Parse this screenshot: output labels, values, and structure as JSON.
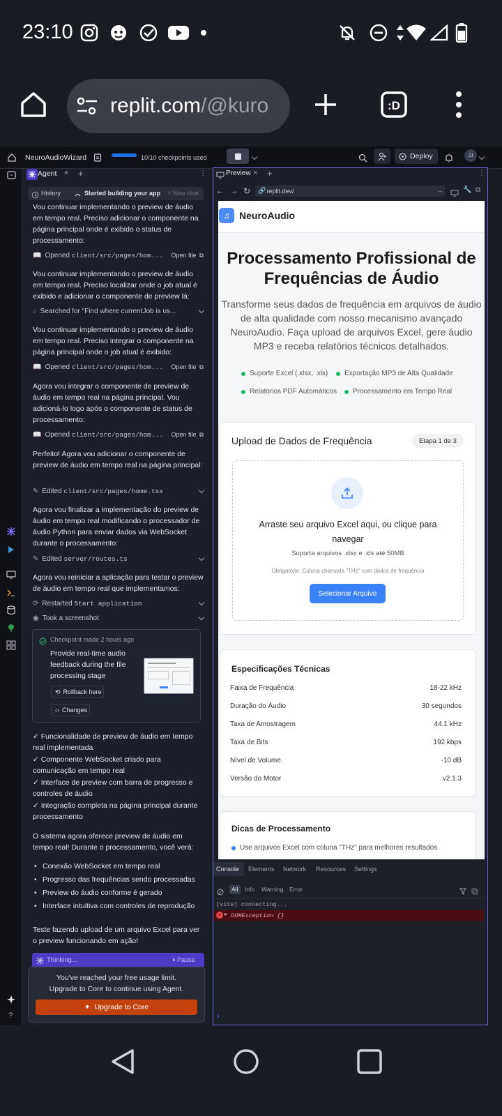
{
  "status_bar": {
    "time": "23:10",
    "left_icons": [
      "instagram-icon",
      "avatar-app-icon",
      "check-circle-icon",
      "youtube-icon",
      "dot-icon"
    ],
    "right_icons": [
      "mute-icon",
      "dnd-icon",
      "data-arrows-icon",
      "wifi-icon",
      "signal-icon",
      "battery-icon"
    ]
  },
  "browser": {
    "url_main": "replit.com",
    "url_rest": "/@kuro"
  },
  "replit_bar": {
    "project_name": "NeuroAudioWizard",
    "checkpoints": "10/10 checkpoints used",
    "deploy_label": "Deploy",
    "avatar_initials": "JJ"
  },
  "agent": {
    "tab_label": "Agent",
    "history_label": "History",
    "started_label": "Started building your app",
    "new_chat_label": "+ New chat",
    "top_partial": "Vou continuar implementando o preview de áudio em tempo real. Preciso adicionar o componente na página principal onde é exibido o status de processamento:",
    "act1_label": "Opened",
    "act1_path": "client/src/pages/hom...",
    "open_file": "Open file",
    "msg2": "Vou continuar implementando o preview de áudio em tempo real. Preciso localizar onde o job atual é exibido e adicionar o componente de preview lá:",
    "act2": "Searched for \"Find where currentJob is us...",
    "msg3": "Vou continuar implementando o preview de áudio em tempo real. Preciso integrar o componente na página principal onde o job atual é exibido:",
    "msg4": "Agora vou integrar o componente de preview de áudio em tempo real na página principal. Vou adicioná-lo logo após o componente de status de processamento:",
    "msg5": "Perfeito! Agora vou adicionar o componente de preview de áudio em tempo real na página principal:",
    "act5_label": "Edited",
    "act5_path": "client/src/pages/home.tsx",
    "msg6": "Agora vou finalizar a implementação do preview de áudio em tempo real modificando o processador de áudio Python para enviar dados via WebSocket durante o processamento:",
    "act6_path": "server/routes.ts",
    "msg7": "Agora vou reiniciar a aplicação para testar o preview de áudio em tempo real que implementamos:",
    "act7_label": "Restarted",
    "act7_code": "Start application",
    "act8": "Took a screenshot",
    "checkpoint": {
      "header": "Checkpoint made 2 hours ago",
      "title": "Provide real-time audio feedback during the file processing stage",
      "rollback": "Rollback here",
      "changes": "Changes"
    },
    "checks": [
      "✓ Funcionalidade de preview de áudio em tempo real implementada",
      "✓ Componente WebSocket criado para comunicação em tempo real",
      "✓ Interface de preview com barra de progresso e controles de áudio",
      "✓ Integração completa na página principal durante processamento"
    ],
    "summary": "O sistema agora oferece preview de áudio em tempo real! Durante o processamento, você verá:",
    "bullets": [
      "Conexão WebSocket em tempo real",
      "Progresso das frequências sendo processadas",
      "Preview do áudio conforme é gerado",
      "Interface intuitiva com controles de reprodução"
    ],
    "final": "Teste fazendo upload de um arquivo Excel para ver o preview funcionando em ação!",
    "thinking": "Thinking...",
    "pause": "Pause",
    "limit_line1": "You've reached your free usage limit.",
    "limit_line2": "Upgrade to Core to continue using Agent.",
    "upgrade": "Upgrade to Core"
  },
  "preview": {
    "tab_label": "Preview",
    "url": ".replit.dev/",
    "app_name": "NeuroAudio",
    "hero_title": "Processamento Profissional de Frequências de Áudio",
    "hero_sub": "Transforme seus dados de frequência em arquivos de áudio de alta qualidade com nosso mecanismo avançado NeuroAudio. Faça upload de arquivos Excel, gere áudio MP3 e receba relatórios técnicos detalhados.",
    "features": [
      "Suporte Excel (.xlsx, .xls)",
      "Exportação MP3 de Alta Qualidade",
      "Relatórios PDF Automáticos",
      "Processamento em Tempo Real"
    ],
    "upload_title": "Upload de Dados de Frequência",
    "step": "Etapa 1 de 3",
    "drop_title": "Arraste seu arquivo Excel aqui, ou clique para navegar",
    "drop_sub": "Suporta arquivos .xlsx e .xls até 50MB",
    "drop_req": "Obrigatório: Coluna chamada \"THz\" com dados de frequência",
    "select_btn": "Selecionar Arquivo",
    "specs_title": "Especificações Técnicas",
    "specs": [
      {
        "label": "Faixa de Frequência",
        "value": "18-22 kHz"
      },
      {
        "label": "Duração do Áudio",
        "value": "30 segundos"
      },
      {
        "label": "Taxa de Amostragem",
        "value": "44.1 kHz"
      },
      {
        "label": "Taxa de Bits",
        "value": "192 kbps"
      },
      {
        "label": "Nível de Volume",
        "value": "-10 dB"
      },
      {
        "label": "Versão do Motor",
        "value": "v2.1.3"
      }
    ],
    "tips_title": "Dicas de Processamento",
    "tip1": "Use arquivos Excel com coluna \"THz\" para melhores resultados"
  },
  "console": {
    "tabs": [
      "Console",
      "Elements",
      "Network",
      "Resources",
      "Settings"
    ],
    "filters": [
      "All",
      "Info",
      "Warning",
      "Error"
    ],
    "line1": "[vite] connecting...",
    "line2": "DOMException {}",
    "prompt": "›"
  },
  "colors": {
    "accent": "#3b82f6",
    "upgrade": "#c2410c",
    "thinking": "#4c3bc4",
    "error_bg": "#4a0d12"
  }
}
